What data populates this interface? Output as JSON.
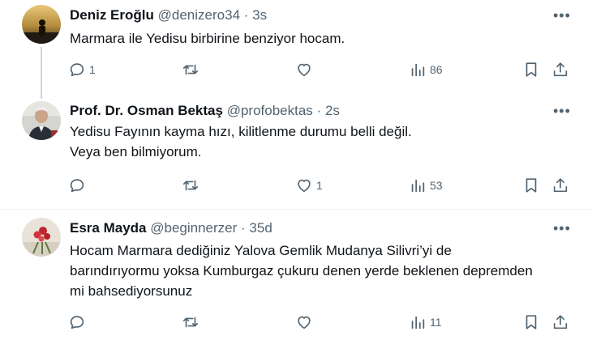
{
  "tweets": [
    {
      "name": "Deniz Eroğlu",
      "handle": "@denizero34",
      "time": "3s",
      "text_lines": [
        "Marmara ile Yedisu birbirine benziyor hocam."
      ],
      "reply_count": "1",
      "retweet_count": "",
      "like_count": "",
      "view_count": "86"
    },
    {
      "name": "Prof. Dr. Osman Bektaş",
      "handle": "@profobektas",
      "time": "2s",
      "text_lines": [
        "Yedisu Fayının kayma hızı, kilitlenme durumu belli değil.",
        "Veya ben bilmiyorum."
      ],
      "reply_count": "",
      "retweet_count": "",
      "like_count": "1",
      "view_count": "53"
    },
    {
      "name": "Esra Mayda",
      "handle": "@beginnerzer",
      "time": "35d",
      "text_lines": [
        "Hocam Marmara dediğiniz Yalova Gemlik Mudanya Silivri’yi de",
        "barındırıyormu yoksa Kumburgaz çukuru denen yerde beklenen depremden",
        "mi bahsediyorsunuz"
      ],
      "reply_count": "",
      "retweet_count": "",
      "like_count": "",
      "view_count": "11"
    }
  ],
  "ui": {
    "separator": "·",
    "more_glyph": "•••",
    "icons": [
      "reply-icon",
      "retweet-icon",
      "like-icon",
      "views-icon",
      "bookmark-icon",
      "share-icon"
    ]
  }
}
